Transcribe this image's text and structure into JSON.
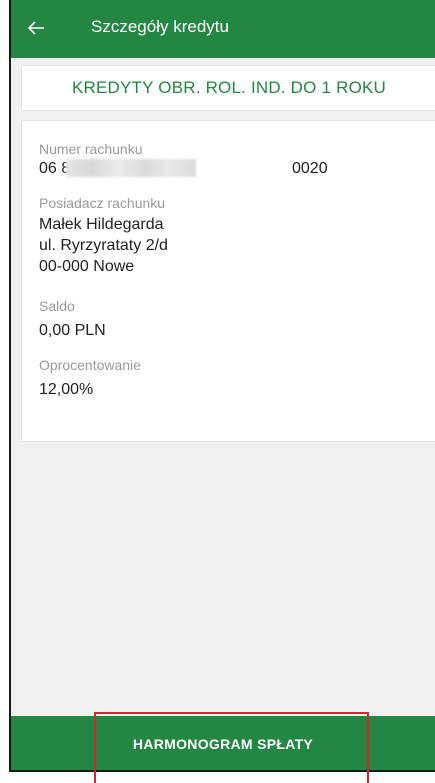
{
  "appbar": {
    "title": "Szczegóły kredytu",
    "back_icon": "arrow-left-icon",
    "color": "#238743"
  },
  "product": {
    "name": "KREDYTY OBR. ROL. IND. DO 1 ROKU"
  },
  "details": {
    "account_number_label": "Numer rachunku",
    "account_number_prefix": "06 8",
    "account_number_suffix": "0020",
    "holder_label": "Posiadacz rachunku",
    "holder_name": "Małek Hildegarda",
    "holder_street": "ul. Ryrzyrataty 2/d",
    "holder_city": "00-000 Nowe",
    "balance_label": "Saldo",
    "balance_value": "0,00 PLN",
    "interest_label": "Oprocentowanie",
    "interest_value": "12,00%"
  },
  "actions": {
    "schedule_label": "HARMONOGRAM SPŁATY"
  },
  "colors": {
    "brand_green": "#238743",
    "highlight_red": "#d7262b"
  }
}
